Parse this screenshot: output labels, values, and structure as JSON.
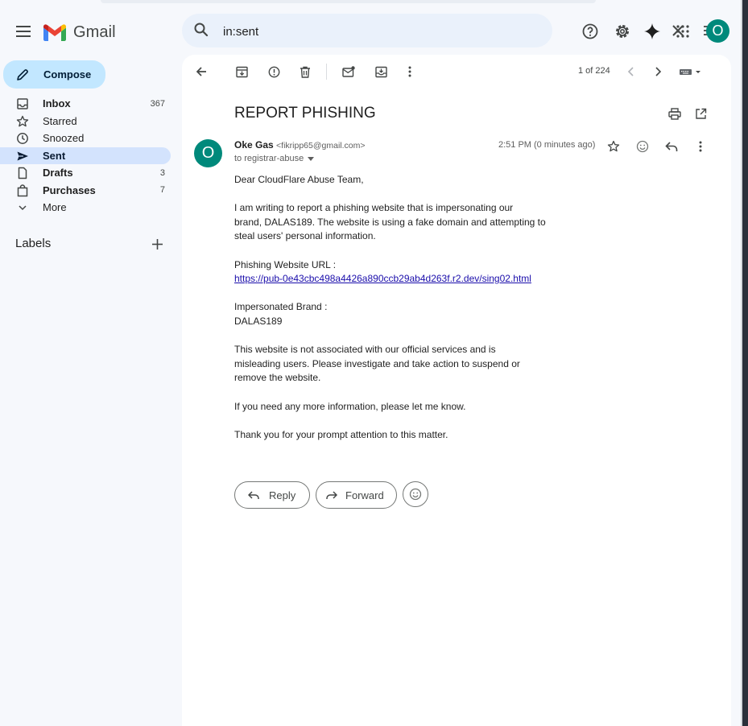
{
  "app": {
    "name": "Gmail"
  },
  "search": {
    "value": "in:sent"
  },
  "account": {
    "avatar_letter": "O"
  },
  "sidebar": {
    "compose_label": "Compose",
    "items": [
      {
        "label": "Inbox",
        "count": "367"
      },
      {
        "label": "Starred",
        "count": ""
      },
      {
        "label": "Snoozed",
        "count": ""
      },
      {
        "label": "Sent",
        "count": ""
      },
      {
        "label": "Drafts",
        "count": "3"
      },
      {
        "label": "Purchases",
        "count": "7"
      },
      {
        "label": "More",
        "count": ""
      }
    ],
    "labels_title": "Labels"
  },
  "toolbar": {
    "pager": "1 of 224"
  },
  "email": {
    "subject": "REPORT PHISHING",
    "sender_name": "Oke Gas",
    "sender_email": "<fikripp65@gmail.com>",
    "to": "to registrar-abuse",
    "time": "2:51 PM (0 minutes ago)",
    "avatar_letter": "O",
    "greeting": "Dear CloudFlare Abuse Team,",
    "para1_line1": "I am writing to report a phishing website that is impersonating our",
    "para1_line2": "brand, DALAS189. The website is using a fake domain and attempting to",
    "para1_line3": "steal users' personal information.",
    "url_label": "Phishing Website URL :",
    "url": "https://pub-0e43cbc498a4426a890ccb29ab4d263f.r2.dev/sing02.html",
    "brand_label": "Impersonated Brand :",
    "brand": "DALAS189",
    "para2_line1": "This website is not associated with our official services and is",
    "para2_line2": "misleading users. Please investigate and take action to suspend or",
    "para2_line3": "remove the website.",
    "para3": "If you need any more information, please let me know.",
    "para4": "Thank you for your prompt attention to this matter."
  },
  "actions": {
    "reply_label": "Reply",
    "forward_label": "Forward"
  }
}
